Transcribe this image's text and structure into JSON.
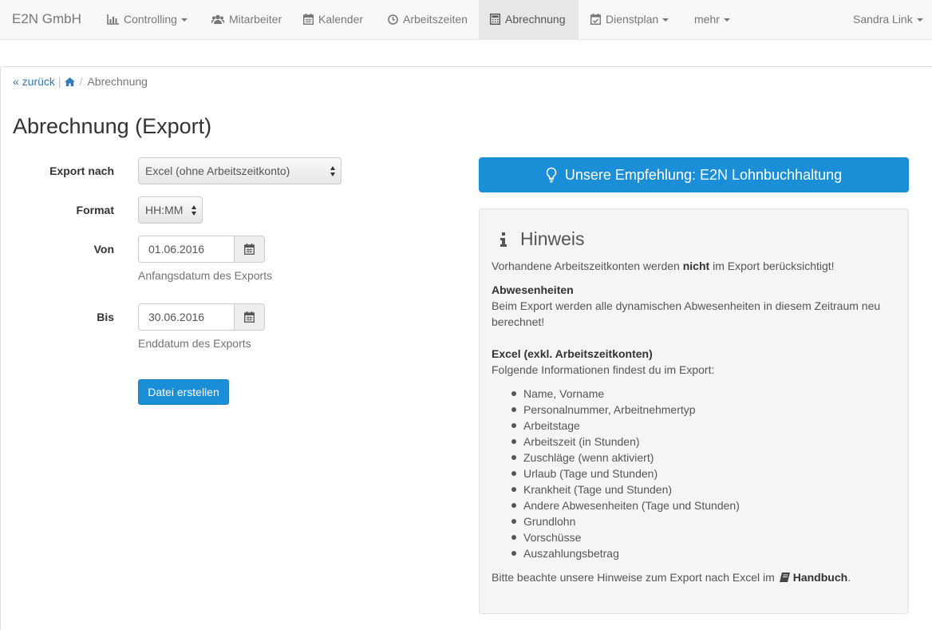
{
  "navbar": {
    "brand": "E2N GmbH",
    "items": [
      {
        "label": "Controlling",
        "icon": "bar-chart-icon",
        "dropdown": true
      },
      {
        "label": "Mitarbeiter",
        "icon": "users-icon",
        "dropdown": false
      },
      {
        "label": "Kalender",
        "icon": "calendar-icon",
        "dropdown": false
      },
      {
        "label": "Arbeitszeiten",
        "icon": "clock-icon",
        "dropdown": false
      },
      {
        "label": "Abrechnung",
        "icon": "calculator-icon",
        "dropdown": false,
        "active": true
      },
      {
        "label": "Dienstplan",
        "icon": "calendar-check-icon",
        "dropdown": true
      },
      {
        "label": "mehr",
        "dropdown": true
      }
    ],
    "user": "Sandra Link"
  },
  "breadcrumb": {
    "back": "« zurück",
    "home_icon": "home-icon",
    "current": "Abrechnung"
  },
  "page_title": "Abrechnung (Export)",
  "form": {
    "export_label": "Export nach",
    "export_value": "Excel (ohne Arbeitszeitkonto)",
    "format_label": "Format",
    "format_value": "HH:MM",
    "von_label": "Von",
    "von_value": "01.06.2016",
    "von_help": "Anfangsdatum des Exports",
    "bis_label": "Bis",
    "bis_value": "30.06.2016",
    "bis_help": "Enddatum des Exports",
    "submit": "Datei erstellen"
  },
  "recommendation": {
    "label": "Unsere Empfehlung: E2N Lohnbuchhaltung",
    "icon": "lightbulb-icon"
  },
  "hinweis": {
    "title": "Hinweis",
    "intro_pre": "Vorhandene Arbeitszeitkonten werden ",
    "intro_bold": "nicht",
    "intro_post": " im Export berücksichtigt!",
    "abw_title": "Abwesenheiten",
    "abw_text_1": "Beim Export werden alle dynamischen Abwesenheiten in diesem Zeitraum neu",
    "abw_text_2": "berechnet!",
    "excel_title": "Excel (exkl. Arbeitszeitkonten)",
    "excel_text": "Folgende Informationen findest du im Export:",
    "items": [
      "Name, Vorname",
      "Personalnummer, Arbeitnehmertyp",
      "Arbeitstage",
      "Arbeitszeit (in Stunden)",
      "Zuschläge (wenn aktiviert)",
      "Urlaub (Tage und Stunden)",
      "Krankheit (Tage und Stunden)",
      "Andere Abwesenheiten (Tage und Stunden)",
      "Grundlohn",
      "Vorschüsse",
      "Auszahlungsbetrag"
    ],
    "footer_pre": "Bitte beachte unsere Hinweise zum Export nach Excel im ",
    "footer_link": "Handbuch",
    "footer_post": "."
  },
  "colors": {
    "primary": "#1a8fd8",
    "link": "#337ab7",
    "navbar_bg": "#f8f8f8",
    "well_bg": "#f5f5f5"
  }
}
